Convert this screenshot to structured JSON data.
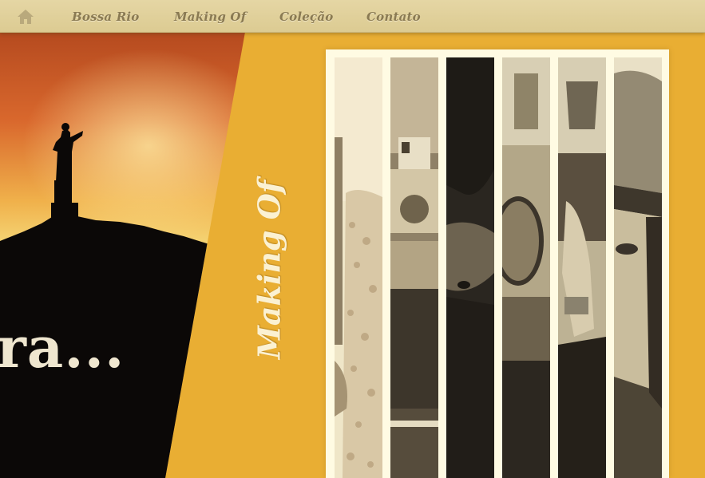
{
  "nav": {
    "home_icon": "home-icon",
    "items": [
      {
        "label": "Bossa Rio"
      },
      {
        "label": "Making Of"
      },
      {
        "label": "Coleção"
      },
      {
        "label": "Contato"
      }
    ]
  },
  "hero": {
    "text": "ra..."
  },
  "section": {
    "title": "Making Of"
  },
  "gallery": {
    "strips": [
      {
        "name": "photo-strip-1"
      },
      {
        "name": "photo-strip-2"
      },
      {
        "name": "photo-strip-3"
      },
      {
        "name": "photo-strip-4"
      },
      {
        "name": "photo-strip-5"
      },
      {
        "name": "photo-strip-6"
      }
    ]
  },
  "colors": {
    "background": "#e9ae33",
    "nav_bar": "#dfcf97",
    "nav_text": "#8a7a52",
    "frame": "#fffbe3",
    "title_text": "#fbf1d2"
  }
}
